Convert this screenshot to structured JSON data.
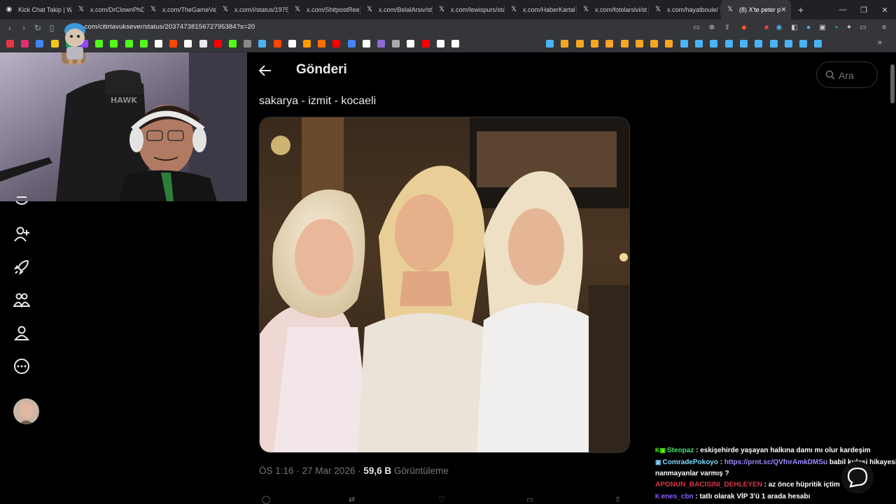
{
  "browser": {
    "tabs": [
      {
        "label": "Kick Chat Takip | W",
        "icon": "kick-icon",
        "active": false
      },
      {
        "label": "x.com/DrClownPhD",
        "icon": "x-icon",
        "active": false
      },
      {
        "label": "x.com/TheGameVer",
        "icon": "x-icon",
        "active": false
      },
      {
        "label": "x.com/i/status/1975",
        "icon": "x-icon",
        "active": false
      },
      {
        "label": "x.com/ShitpostReel",
        "icon": "x-icon",
        "active": false
      },
      {
        "label": "x.com/BelalArsiv/st",
        "icon": "x-icon",
        "active": false
      },
      {
        "label": "x.com/lewispurs/sta",
        "icon": "x-icon",
        "active": false
      },
      {
        "label": "x.com/HaberKartal",
        "icon": "x-icon",
        "active": false
      },
      {
        "label": "x.com/fotolarsivi/st",
        "icon": "x-icon",
        "active": false
      },
      {
        "label": "x.com/hayatboule/",
        "icon": "x-icon",
        "active": false
      },
      {
        "label": "(8) X'te peter p",
        "icon": "x-icon",
        "active": true
      }
    ],
    "url": ".com/citirtavuksever/status/2037473815672795384?s=20"
  },
  "post": {
    "header_title": "Gönderi",
    "text": "sakarya - izmit - kocaeli",
    "time": "ÖS 1:16",
    "date": "27 Mar 2026",
    "views": "59,6 B",
    "views_label": "Görüntüleme"
  },
  "search": {
    "placeholder": "Ara"
  },
  "chat": [
    {
      "user": "Steopaz",
      "user_color": "#3ee06b",
      "message": "eskişehirde yaşayan halkına damı mı olur kardeşim"
    },
    {
      "user": "ComradePokoyo",
      "user_color": "#7fd8ff",
      "link": "https://prnt.sc/QVfnrAmkDMSu",
      "message": "babil kulesi hikayesini"
    },
    {
      "user": "",
      "user_color": "#fff",
      "message": "nanmayanlar varmış ?"
    },
    {
      "user": "APONUN_BACISINI_DEHLEYEN",
      "user_color": "#d6334a",
      "message": "az önce hüpritik içtim"
    },
    {
      "user": "enes_cbn",
      "user_color": "#8a5cff",
      "message": "tatlı olarak VİP 3'ü 1 arada hesabı"
    }
  ]
}
